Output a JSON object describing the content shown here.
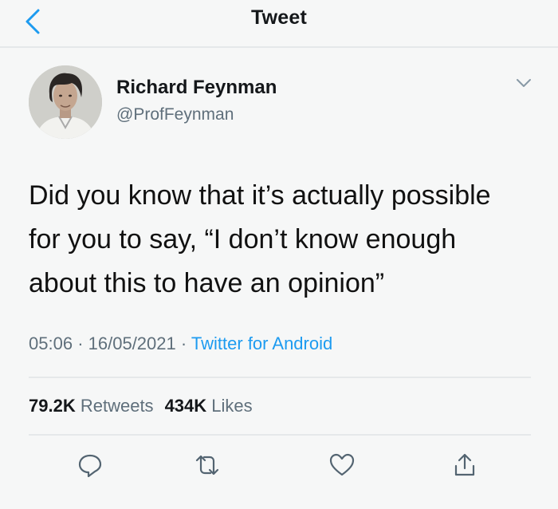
{
  "header": {
    "title": "Tweet",
    "back_icon": "chevron-left-icon"
  },
  "author": {
    "name": "Richard Feynman",
    "handle": "@ProfFeynman",
    "menu_icon": "chevron-down-icon"
  },
  "tweet": {
    "text_lines": [
      "Did you know that it’s actually possible",
      "for you to say, “I don’t know enough",
      "about this to have an opinion”"
    ],
    "time": "05:06",
    "date": "16/05/2021",
    "source": "Twitter for Android"
  },
  "stats": {
    "retweets_count": "79.2K",
    "retweets_label": "Retweets",
    "likes_count": "434K",
    "likes_label": "Likes"
  },
  "actions": {
    "reply_icon": "reply-icon",
    "retweet_icon": "retweet-icon",
    "like_icon": "heart-icon",
    "share_icon": "share-icon"
  },
  "colors": {
    "accent": "#1d9bf0",
    "text": "#14171a",
    "secondary": "#5f6f7b",
    "background": "#f6f7f7"
  }
}
